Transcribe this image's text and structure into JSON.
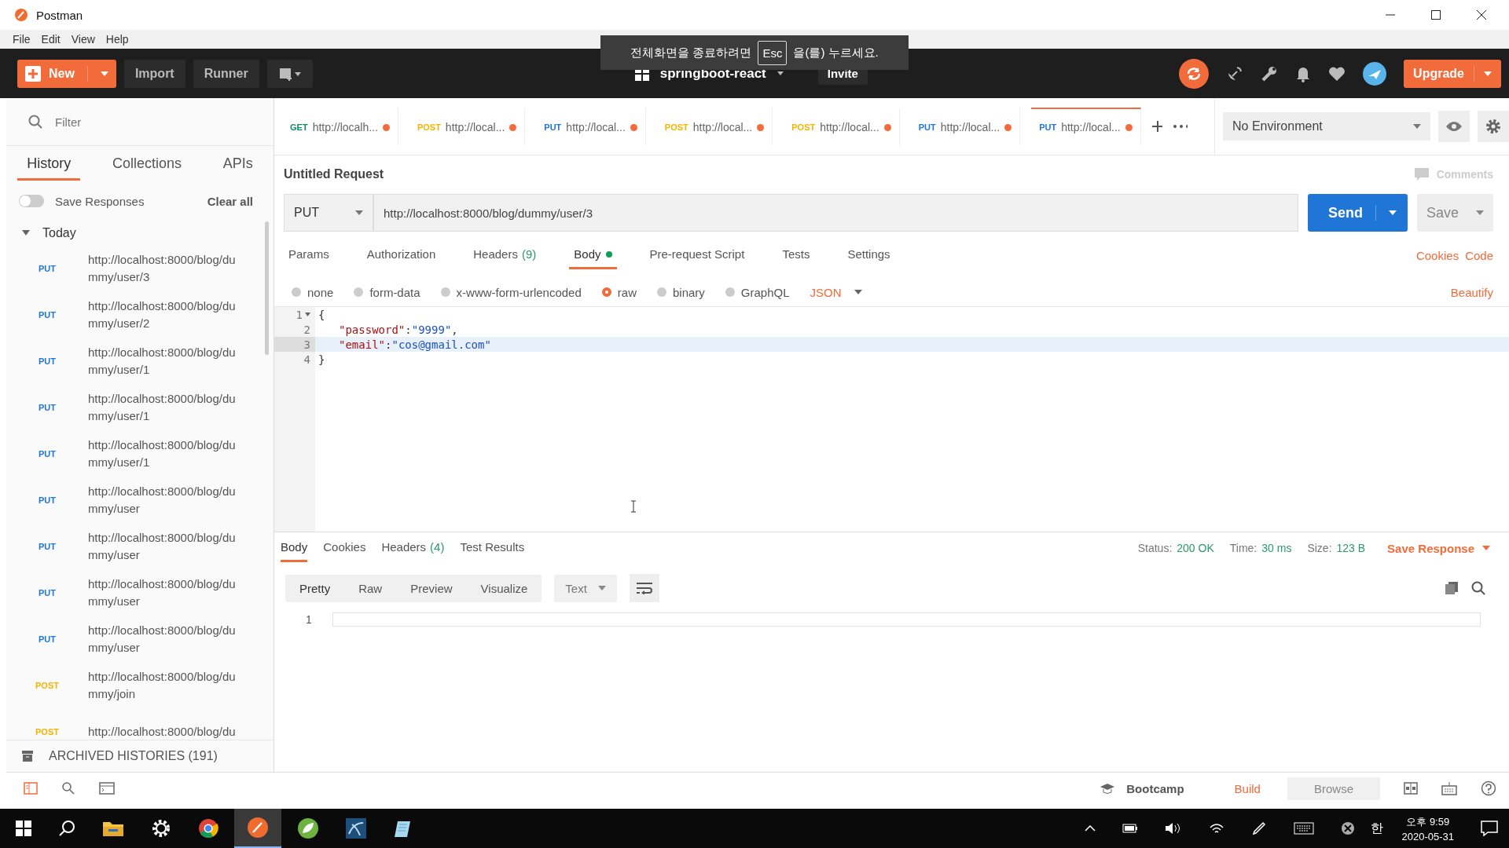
{
  "window": {
    "title": "Postman",
    "menu": [
      "File",
      "Edit",
      "View",
      "Help"
    ]
  },
  "header": {
    "new": "New",
    "import": "Import",
    "runner": "Runner",
    "workspace": "springboot-react",
    "invite": "Invite",
    "upgrade": "Upgrade"
  },
  "toast": {
    "before": "전체화면을 종료하려면",
    "key": "Esc",
    "after": "을(를) 누르세요."
  },
  "sidebar": {
    "filter": {
      "placeholder": "Filter"
    },
    "tabs": [
      {
        "label": "History",
        "selected": true
      },
      {
        "label": "Collections",
        "selected": false
      },
      {
        "label": "APIs",
        "selected": false
      }
    ],
    "save_responses": {
      "label": "Save Responses",
      "on": false
    },
    "clear_all": "Clear all",
    "group": {
      "label": "Today",
      "expanded": true,
      "items": [
        {
          "method": "PUT",
          "color": "#1f76d6",
          "url": "http://localhost:8000/blog/du",
          "url_2": "mmy/user/3"
        },
        {
          "method": "PUT",
          "color": "#1f76d6",
          "url": "http://localhost:8000/blog/du",
          "url_2": "mmy/user/2"
        },
        {
          "method": "PUT",
          "color": "#1f76d6",
          "url": "http://localhost:8000/blog/du",
          "url_2": "mmy/user/1"
        },
        {
          "method": "PUT",
          "color": "#1f76d6",
          "url": "http://localhost:8000/blog/du",
          "url_2": "mmy/user/1"
        },
        {
          "method": "PUT",
          "color": "#1f76d6",
          "url": "http://localhost:8000/blog/du",
          "url_2": "mmy/user/1"
        },
        {
          "method": "PUT",
          "color": "#1f76d6",
          "url": "http://localhost:8000/blog/du",
          "url_2": "mmy/user"
        },
        {
          "method": "PUT",
          "color": "#1f76d6",
          "url": "http://localhost:8000/blog/du",
          "url_2": "mmy/user"
        },
        {
          "method": "PUT",
          "color": "#1f76d6",
          "url": "http://localhost:8000/blog/du",
          "url_2": "mmy/user"
        },
        {
          "method": "PUT",
          "color": "#1f76d6",
          "url": "http://localhost:8000/blog/du",
          "url_2": "mmy/user"
        },
        {
          "method": "POST",
          "color": "#f4b400",
          "url": "http://localhost:8000/blog/du",
          "url_2": "mmy/join"
        },
        {
          "method": "POST",
          "color": "#f4b400",
          "url": "http://localhost:8000/blog/du"
        }
      ]
    },
    "archived": "ARCHIVED HISTORIES (191)"
  },
  "request_tabs": [
    {
      "method": "GET",
      "color": "#0f8a5f",
      "label": "http://localh...",
      "selected": false
    },
    {
      "method": "POST",
      "color": "#f4b400",
      "label": "http://local...",
      "selected": false
    },
    {
      "method": "PUT",
      "color": "#1f76d6",
      "label": "http://local...",
      "selected": false
    },
    {
      "method": "POST",
      "color": "#f4b400",
      "label": "http://local...",
      "selected": false
    },
    {
      "method": "POST",
      "color": "#f4b400",
      "label": "http://local...",
      "selected": false
    },
    {
      "method": "PUT",
      "color": "#1f76d6",
      "label": "http://local...",
      "selected": false
    },
    {
      "method": "PUT",
      "color": "#1f76d6",
      "label": "http://local...",
      "selected": true
    }
  ],
  "environment": "No Environment",
  "request": {
    "title": "Untitled Request",
    "comments": "Comments",
    "method": "PUT",
    "url": "http://localhost:8000/blog/dummy/user/3",
    "send": "Send",
    "save": "Save",
    "tabs": [
      {
        "label": "Params",
        "selected": false
      },
      {
        "label": "Authorization",
        "selected": false
      },
      {
        "label": "Headers",
        "count": "(9)",
        "selected": false
      },
      {
        "label": "Body",
        "dot": true,
        "selected": true
      },
      {
        "label": "Pre-request Script",
        "selected": false
      },
      {
        "label": "Tests",
        "selected": false
      },
      {
        "label": "Settings",
        "selected": false
      }
    ],
    "cookies": "Cookies",
    "code": "Code",
    "body_types": [
      {
        "label": "none",
        "selected": false
      },
      {
        "label": "form-data",
        "selected": false
      },
      {
        "label": "x-www-form-urlencoded",
        "selected": false
      },
      {
        "label": "raw",
        "selected": true
      },
      {
        "label": "binary",
        "selected": false
      },
      {
        "label": "GraphQL",
        "selected": false
      }
    ],
    "format": "JSON",
    "beautify": "Beautify",
    "lines": [
      {
        "number": "1",
        "foldable": true,
        "active": false,
        "tokens": [
          {
            "kind": "punct",
            "text": "{"
          }
        ]
      },
      {
        "number": "2",
        "foldable": false,
        "active": false,
        "tokens": [
          {
            "kind": "key",
            "text": "\"password\""
          },
          {
            "kind": "punct",
            "text": ":"
          },
          {
            "kind": "string",
            "text": "\"9999\""
          },
          {
            "kind": "punct",
            "text": ","
          }
        ]
      },
      {
        "number": "3",
        "foldable": false,
        "active": true,
        "tokens": [
          {
            "kind": "key",
            "text": "\"email\""
          },
          {
            "kind": "punct",
            "text": ":"
          },
          {
            "kind": "string",
            "text": "\"cos@gmail.com\""
          }
        ]
      },
      {
        "number": "4",
        "foldable": false,
        "active": false,
        "tokens": [
          {
            "kind": "punct",
            "text": "}"
          }
        ]
      }
    ]
  },
  "response": {
    "tabs": [
      {
        "label": "Body",
        "selected": true
      },
      {
        "label": "Cookies",
        "selected": false
      },
      {
        "label": "Headers",
        "count": "(4)",
        "selected": false
      },
      {
        "label": "Test Results",
        "selected": false
      }
    ],
    "status_label": "Status:",
    "status": "200 OK",
    "time_label": "Time:",
    "time": "30 ms",
    "size_label": "Size:",
    "size": "123 B",
    "save_response": "Save Response",
    "views": [
      {
        "label": "Pretty",
        "selected": true
      },
      {
        "label": "Raw",
        "selected": false
      },
      {
        "label": "Preview",
        "selected": false
      },
      {
        "label": "Visualize",
        "selected": false
      }
    ],
    "format": "Text",
    "line": "1"
  },
  "footer": {
    "bootcamp": "Bootcamp",
    "modes": [
      {
        "label": "Build",
        "selected": true
      },
      {
        "label": "Browse",
        "selected": false
      }
    ]
  },
  "taskbar": {
    "ime": "한",
    "time": "오후 9:59",
    "date": "2020-05-31"
  }
}
